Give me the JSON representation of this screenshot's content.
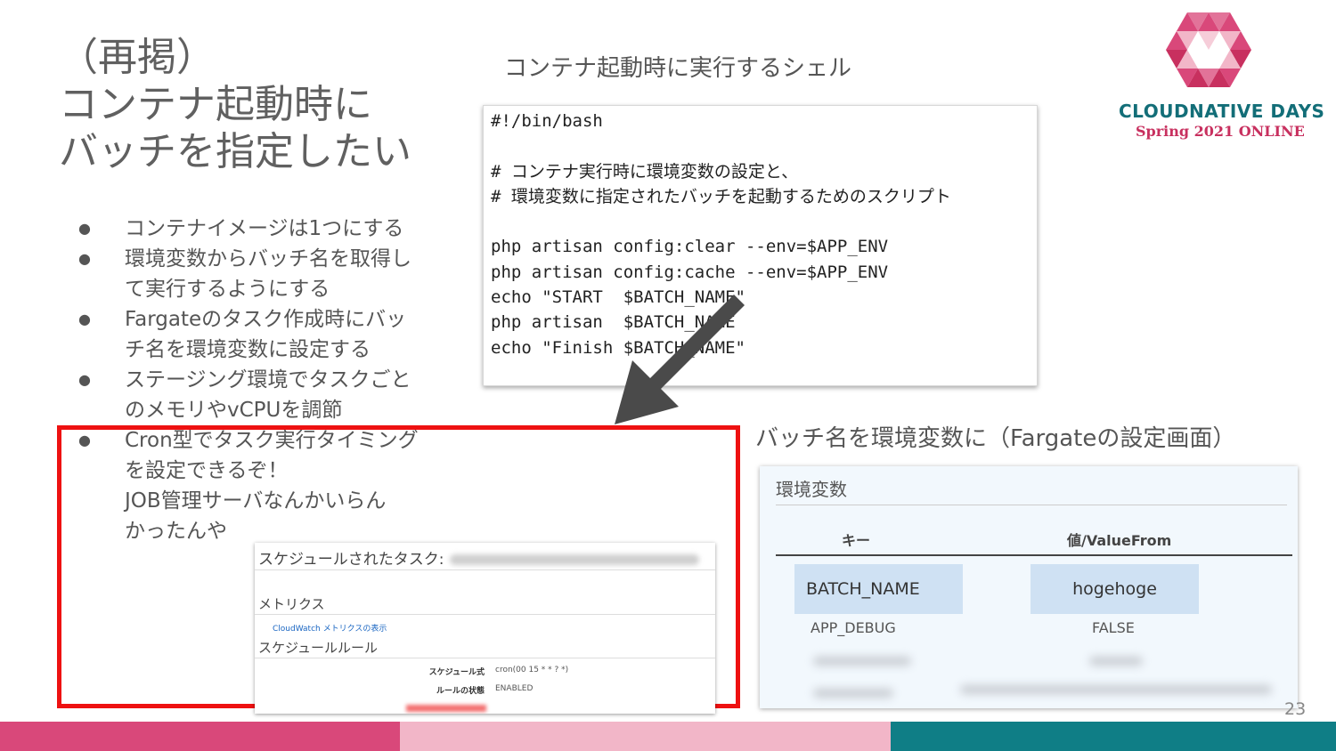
{
  "title": {
    "lines": [
      "（再掲）",
      "コンテナ起動時に",
      "バッチを指定したい"
    ]
  },
  "bullets": [
    {
      "lines": [
        "コンテナイメージは1つにする"
      ]
    },
    {
      "lines": [
        "環境変数からバッチ名を取得し",
        "て実行するようにする"
      ]
    },
    {
      "lines": [
        "Fargateのタスク作成時にバッ",
        "チ名を環境変数に設定する"
      ]
    },
    {
      "lines": [
        "ステージング環境でタスクごと",
        "のメモリやvCPUを調節"
      ]
    },
    {
      "lines": [
        "Cron型でタスク実行タイミング",
        "を設定できるぞ！",
        "JOB管理サーバなんかいらん",
        "かったんや"
      ]
    }
  ],
  "shell": {
    "caption": "コンテナ起動時に実行するシェル",
    "code_lines": [
      "#!/bin/bash",
      "",
      "# コンテナ実行時に環境変数の設定と、",
      "# 環境変数に指定されたバッチを起動するためのスクリプト",
      "",
      "php artisan config:clear --env=$APP_ENV",
      "php artisan config:cache --env=$APP_ENV",
      "echo \"START  $BATCH_NAME\"",
      "php artisan  $BATCH_NAME",
      "echo \"Finish $BATCH_NAME\""
    ]
  },
  "task_screenshot": {
    "heading": "スケジュールされたタスク:",
    "metrics_heading": "メトリクス",
    "cloudwatch_link": "CloudWatch メトリクスの表示",
    "schedule_heading": "スケジュールルール",
    "rows": [
      {
        "key": "スケジュール式",
        "value": "cron(00 15 * * ? *)"
      },
      {
        "key": "ルールの状態",
        "value": "ENABLED"
      }
    ]
  },
  "fargate": {
    "caption": "バッチ名を環境変数に（Fargateの設定画面）",
    "panel_title": "環境変数",
    "col_key": "キー",
    "col_value": "値/ValueFrom",
    "row1": {
      "key": "BATCH_NAME",
      "value": "hogehoge"
    },
    "row2": {
      "key": "APP_DEBUG",
      "value": "FALSE"
    }
  },
  "page_number": "23",
  "logo": {
    "name": "CLOUDNATIVE DAYS",
    "subtitle": "Spring 2021 ONLINE"
  },
  "colors": {
    "accent_red": "#ee1111",
    "footer_pink": "#d9487a",
    "footer_light_pink": "#f2b6c8",
    "footer_teal": "#0f7e86",
    "arrow": "#4a4a4a"
  }
}
